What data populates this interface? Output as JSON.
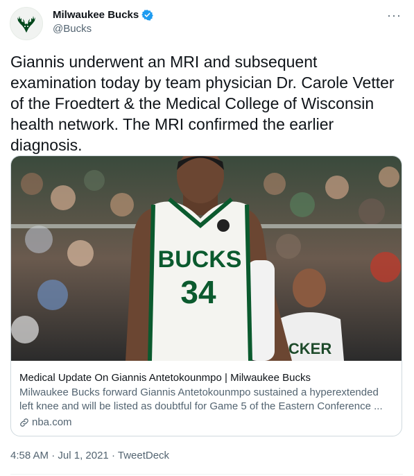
{
  "author": {
    "display_name": "Milwaukee Bucks",
    "handle": "@Bucks",
    "verified": true,
    "avatar_icon": "deer-logo-icon",
    "brand_color": "#00471B"
  },
  "more_menu_label": "···",
  "tweet": {
    "text": "Giannis underwent an MRI and subsequent examination today by team physician Dr. Carole Vetter of the Froedtert & the Medical College of Wisconsin health network. The MRI confirmed the earlier diagnosis."
  },
  "link_card": {
    "image_jersey_text": "BUCKS",
    "image_jersey_number": "34",
    "image_background_jersey_text": "ICKER",
    "title": "Medical Update On Giannis Antetokounmpo | Milwaukee Bucks",
    "description": "Milwaukee Bucks forward Giannis Antetokounmpo sustained a hyperextended left knee and will be listed as doubtful for Game 5 of the Eastern Conference ...",
    "domain": "nba.com",
    "domain_icon": "link-icon"
  },
  "meta": {
    "time": "4:58 AM",
    "separator": "·",
    "date": "Jul 1, 2021",
    "source": "TweetDeck"
  }
}
